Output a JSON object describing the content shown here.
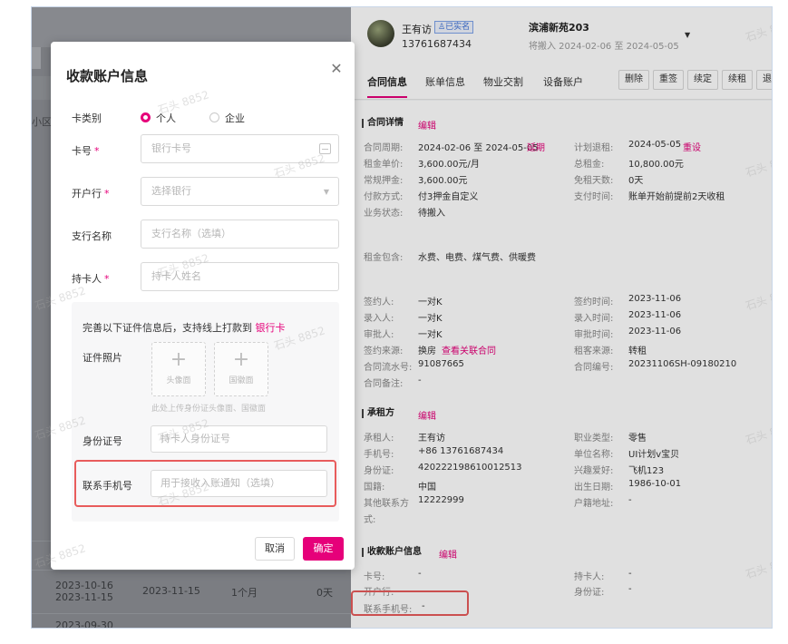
{
  "left_list": {
    "filter_label": "小区",
    "rows": [
      {
        "start": "2023-10-16",
        "end": "2023-11-15",
        "due": "2023-11-15",
        "cycle": "1个月",
        "days": "0天"
      },
      {
        "start": "2023-09-30",
        "end": "",
        "due": "",
        "cycle": "",
        "days": ""
      }
    ]
  },
  "tenant": {
    "name": "王有访",
    "verified": "已实名",
    "phone": "13761687434",
    "room": "滨浦新苑203",
    "period": "将搬入 2024-02-06 至 2024-05-05"
  },
  "tabs": [
    "合同信息",
    "账单信息",
    "物业交割",
    "设备账户"
  ],
  "actions": [
    "删除",
    "重签",
    "续定",
    "续租",
    "退"
  ],
  "contract": {
    "title": "合同详情",
    "edit": "编辑",
    "left": [
      {
        "label": "合同周期:",
        "value": "2024-02-06 至 2024-05-05",
        "link": "延期"
      },
      {
        "label": "租金单价:",
        "value": "3,600.00元/月",
        "link": ""
      },
      {
        "label": "常规押金:",
        "value": "3,600.00元",
        "link": ""
      },
      {
        "label": "付款方式:",
        "value": "付3押金自定义",
        "link": ""
      },
      {
        "label": "业务状态:",
        "value": "待搬入",
        "link": ""
      }
    ],
    "right": [
      {
        "label": "计划退租:",
        "value": "2024-05-05",
        "link": "重设"
      },
      {
        "label": "总租金:",
        "value": "10,800.00元",
        "link": ""
      },
      {
        "label": "免租天数:",
        "value": "0天",
        "link": ""
      },
      {
        "label": "支付时间:",
        "value": "账单开始前提前2天收租",
        "link": ""
      }
    ],
    "rent_includes_label": "租金包含:",
    "rent_includes_value": "水费、电费、煤气费、供暖费",
    "left2": [
      {
        "label": "签约人:",
        "value": "一对K",
        "link": ""
      },
      {
        "label": "录入人:",
        "value": "一对K",
        "link": ""
      },
      {
        "label": "审批人:",
        "value": "一对K",
        "link": ""
      },
      {
        "label": "签约来源:",
        "value": "换房",
        "link": "查看关联合同"
      },
      {
        "label": "合同流水号:",
        "value": "91087665",
        "link": ""
      },
      {
        "label": "合同备注:",
        "value": "-",
        "link": ""
      }
    ],
    "right2": [
      {
        "label": "签约时间:",
        "value": "2023-11-06",
        "link": ""
      },
      {
        "label": "录入时间:",
        "value": "2023-11-06",
        "link": ""
      },
      {
        "label": "审批时间:",
        "value": "2023-11-06",
        "link": ""
      },
      {
        "label": "租客来源:",
        "value": "转租",
        "link": ""
      },
      {
        "label": "合同编号:",
        "value": "20231106SH-09180210",
        "link": ""
      }
    ]
  },
  "renter": {
    "title": "承租方",
    "edit": "编辑",
    "left": [
      {
        "label": "承租人:",
        "value": "王有访"
      },
      {
        "label": "手机号:",
        "value": "+86 13761687434"
      },
      {
        "label": "身份证:",
        "value": "420222198610012513"
      },
      {
        "label": "国籍:",
        "value": "中国"
      },
      {
        "label": "其他联系方",
        "value": "12222999"
      }
    ],
    "left_extra": "式:",
    "right": [
      {
        "label": "职业类型:",
        "value": "零售"
      },
      {
        "label": "单位名称:",
        "value": "UI计划v宝贝"
      },
      {
        "label": "兴趣爱好:",
        "value": "飞机123"
      },
      {
        "label": "出生日期:",
        "value": "1986-10-01"
      },
      {
        "label": "户籍地址:",
        "value": "-"
      }
    ]
  },
  "account_info": {
    "title": "收款账户信息",
    "edit": "编辑",
    "card_label": "卡号:",
    "card_value": "-",
    "bank_label": "开户行:",
    "holder_label": "持卡人:",
    "holder_value": "-",
    "id_label": "身份证:",
    "id_value": "-",
    "phone_label": "联系手机号:",
    "phone_value": "-"
  },
  "modal": {
    "title": "收款账户信息",
    "card_type_label": "卡类别",
    "card_type_options": [
      "个人",
      "企业"
    ],
    "card_no_label": "卡号",
    "card_no_placeholder": "银行卡号",
    "bank_label": "开户行",
    "bank_placeholder": "选择银行",
    "branch_label": "支行名称",
    "branch_placeholder": "支行名称（选填）",
    "holder_label": "持卡人",
    "holder_placeholder": "持卡人姓名",
    "required_mark": "*",
    "cert_note": "完善以下证件信息后，支持线上打款到",
    "cert_note_link": "银行卡",
    "cert_photo_label": "证件照片",
    "upload_front": "头像面",
    "upload_back": "国徽面",
    "upload_hint": "此处上传身份证头像面、国徽面",
    "id_label": "身份证号",
    "id_placeholder": "持卡人身份证号",
    "phone_label": "联系手机号",
    "phone_placeholder": "用于接收入账通知（选填）",
    "cancel": "取消",
    "confirm": "确定"
  },
  "watermark": "石头 8852",
  "colors": {
    "accent": "#e6007a",
    "highlight": "#e85c5c"
  }
}
